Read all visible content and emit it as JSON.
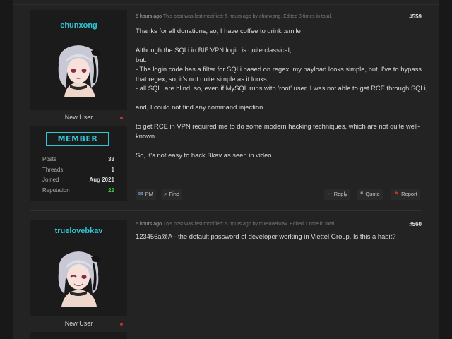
{
  "posts": [
    {
      "username": "chunxong",
      "rank": "New User",
      "badge": "MEMBER",
      "stats": [
        {
          "key": "Posts",
          "value": "33"
        },
        {
          "key": "Threads",
          "value": "1"
        },
        {
          "key": "Joined",
          "value": "Aug 2021"
        },
        {
          "key": "Reputation",
          "value": "22"
        }
      ],
      "time": "5 hours ago",
      "edit_note": "This post was last modified: 5 hours ago by chunxong. Edited 3 times in total.",
      "number": "#559",
      "paragraphs": [
        "Thanks for all donations, so, I have coffee to drink :smile",
        "Although the SQLi in BIF VPN login is quite classical,",
        "but:",
        "- The login code has a filter for SQLi based on regex, my payload looks simple, but, I've to bypass that regex, so, it's not quite simple as it looks.",
        "- all SQLi are blind, so, even if MySQL runs with 'root' user, I was not able to get RCE through SQLi,",
        "and, I could not find any command injection.",
        "to get RCE in VPN required me to do some modern hacking techniques, which are not quite well-known.",
        "So, it's not easy to hack Bkav as seen in video."
      ],
      "buttons": {
        "pm": "PM",
        "find": "Find",
        "reply": "Reply",
        "quote": "Quote",
        "report": "Report"
      }
    },
    {
      "username": "truelovebkav",
      "rank": "New User",
      "time": "5 hours ago",
      "edit_note": "This post was last modified: 5 hours ago by truelovebkav. Edited 1 time in total.",
      "number": "#560",
      "paragraphs": [
        "123456a@A - the default password of developer working in Viettel Group. Is this a habit?"
      ]
    }
  ],
  "colors": {
    "accent": "#2fc5d6",
    "reputation_positive": "#3cbf3c",
    "offline_dot": "#c43131",
    "report_flag": "#c43131"
  }
}
